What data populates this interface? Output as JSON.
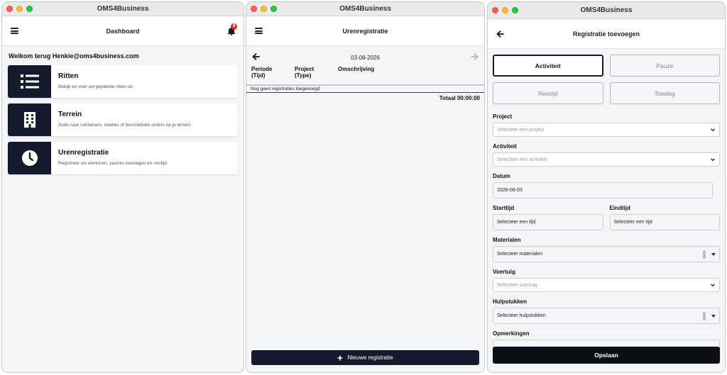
{
  "dashboard_window": {
    "window_title": "OMS4Business",
    "appbar_title": "Dashboard",
    "notification_count": "8",
    "welcome": "Welkom terug Henkie@oms4business.com",
    "cards": [
      {
        "icon": "list-icon",
        "title": "Ritten",
        "desc": "Bekijk en voer uw geplande ritten uit."
      },
      {
        "icon": "building-icon",
        "title": "Terrein",
        "desc": "Zoek naar containers, relaties of beschikbare orders op je terrein."
      },
      {
        "icon": "clock-icon",
        "title": "Urenregistratie",
        "desc": "Registreer uw werkuren, pauzes toeslagen en reistijd."
      }
    ]
  },
  "hours_window": {
    "window_title": "OMS4Business",
    "appbar_title": "Urenregistratie",
    "date": "03-08-2026",
    "columns": [
      {
        "line1": "Periode",
        "line2": "(Tijd)"
      },
      {
        "line1": "Project",
        "line2": "(Type)"
      },
      {
        "line1": "Omschrijving",
        "line2": ""
      }
    ],
    "empty_text": "Nog geen registraties toegevoegd",
    "total": "Totaal 00:00:00",
    "new_button": "Nieuwe registratie"
  },
  "add_window": {
    "window_title": "OMS4Business",
    "appbar_title": "Registratie toevoegen",
    "tabs": [
      "Activiteit",
      "Pauze",
      "Reistijd",
      "Toeslag"
    ],
    "active_tab": "Activiteit",
    "fields": {
      "project_label": "Project",
      "project_placeholder": "Selecteer een project",
      "activiteit_label": "Activiteit",
      "activiteit_placeholder": "Selecteer een activiteit",
      "datum_label": "Datum",
      "datum_value": "2026-08-03",
      "starttijd_label": "Starttijd",
      "starttijd_value": "Selecteer een tijd",
      "eindtijd_label": "Eindtijd",
      "eindtijd_value": "Selecteer een tijd",
      "materialen_label": "Materialen",
      "materialen_placeholder": "Selecteer materialen",
      "voertuig_label": "Voertuig",
      "voertuig_placeholder": "Selecteer voertuig",
      "hulpstukken_label": "Hulpstukken",
      "hulpstukken_placeholder": "Selecteer hulpstukken",
      "opmerkingen_label": "Opmerkingen",
      "opmerkingen_value": ""
    },
    "save_button": "Opslaan"
  },
  "colors": {
    "primary_dark": "#141b2d",
    "badge_red": "#d92a2a",
    "background": "#f4f5f7"
  }
}
